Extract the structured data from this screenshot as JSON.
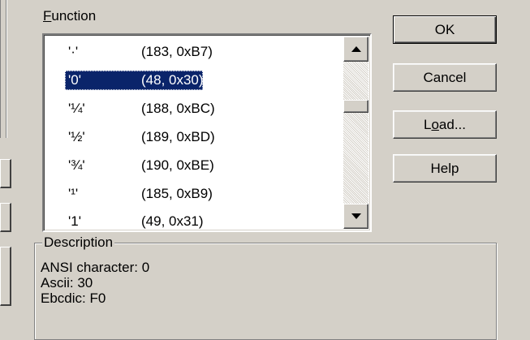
{
  "function_label": "Function",
  "function_label_accel": "F",
  "function_label_rest": "unction",
  "rows": [
    {
      "char": "'·'",
      "code": "(183, 0xB7)",
      "selected": false
    },
    {
      "char": "'0'",
      "code": "(48, 0x30)",
      "selected": true
    },
    {
      "char": "'¼'",
      "code": "(188, 0xBC)",
      "selected": false
    },
    {
      "char": "'½'",
      "code": "(189, 0xBD)",
      "selected": false
    },
    {
      "char": "'¾'",
      "code": "(190, 0xBE)",
      "selected": false
    },
    {
      "char": "'¹'",
      "code": "(185, 0xB9)",
      "selected": false
    },
    {
      "char": "'1'",
      "code": "(49, 0x31)",
      "selected": false
    }
  ],
  "scrollbar": {
    "position_fraction": 0.42
  },
  "buttons": {
    "ok": "OK",
    "cancel": "Cancel",
    "load_pre": "L",
    "load_accel": "o",
    "load_post": "ad...",
    "help": "Help"
  },
  "description": {
    "legend": "Description",
    "line1": "ANSI character:  0",
    "line2": "Ascii:  30",
    "line3": "Ebcdic:  F0"
  },
  "colors": {
    "selection": "#0a246a",
    "face": "#d4d0c8"
  }
}
